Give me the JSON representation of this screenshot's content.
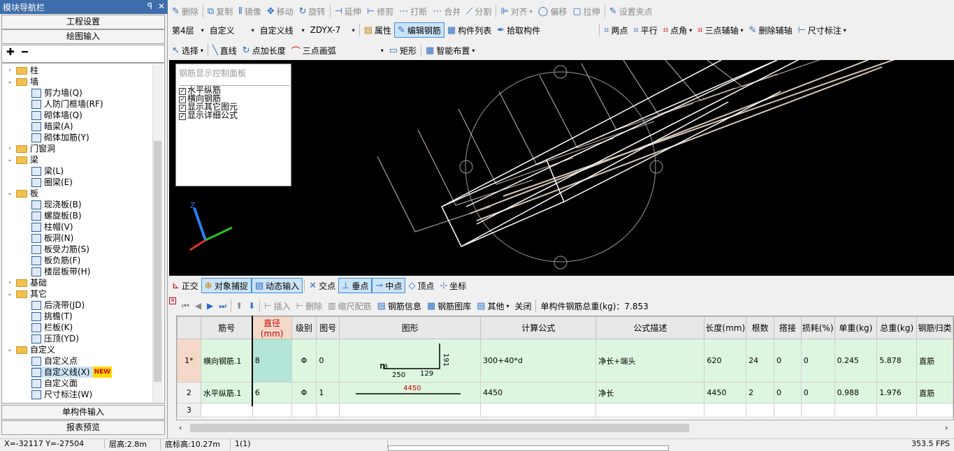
{
  "nav": {
    "title": "模块导航栏",
    "pin": "ᵖ",
    "close": "✕",
    "btn_project": "工程设置",
    "btn_draw": "绘图输入",
    "btn_single": "单构件输入",
    "btn_report": "报表预览",
    "tree_tools": "✚ ━",
    "tree": [
      {
        "label": "柱",
        "exp": "›",
        "type": "folder",
        "level": 0
      },
      {
        "label": "墙",
        "exp": "⌄",
        "type": "folder",
        "level": 0
      },
      {
        "label": "剪力墙(Q)",
        "type": "item",
        "level": 1
      },
      {
        "label": "人防门框墙(RF)",
        "type": "item",
        "level": 1
      },
      {
        "label": "砌体墙(Q)",
        "type": "item",
        "level": 1
      },
      {
        "label": "暗梁(A)",
        "type": "item",
        "level": 1
      },
      {
        "label": "砌体加筋(Y)",
        "type": "item",
        "level": 1
      },
      {
        "label": "门窗洞",
        "exp": "›",
        "type": "folder",
        "level": 0
      },
      {
        "label": "梁",
        "exp": "⌄",
        "type": "folder",
        "level": 0
      },
      {
        "label": "梁(L)",
        "type": "item",
        "level": 1
      },
      {
        "label": "圈梁(E)",
        "type": "item",
        "level": 1
      },
      {
        "label": "板",
        "exp": "⌄",
        "type": "folder",
        "level": 0
      },
      {
        "label": "现浇板(B)",
        "type": "item",
        "level": 1
      },
      {
        "label": "螺旋板(B)",
        "type": "item",
        "level": 1
      },
      {
        "label": "柱帽(V)",
        "type": "item",
        "level": 1
      },
      {
        "label": "板洞(N)",
        "type": "item",
        "level": 1
      },
      {
        "label": "板受力筋(S)",
        "type": "item",
        "level": 1
      },
      {
        "label": "板负筋(F)",
        "type": "item",
        "level": 1
      },
      {
        "label": "楼层板带(H)",
        "type": "item",
        "level": 1
      },
      {
        "label": "基础",
        "exp": "›",
        "type": "folder",
        "level": 0
      },
      {
        "label": "其它",
        "exp": "⌄",
        "type": "folder",
        "level": 0
      },
      {
        "label": "后浇带(JD)",
        "type": "item",
        "level": 1
      },
      {
        "label": "挑檐(T)",
        "type": "item",
        "level": 1
      },
      {
        "label": "栏板(K)",
        "type": "item",
        "level": 1
      },
      {
        "label": "压顶(YD)",
        "type": "item",
        "level": 1
      },
      {
        "label": "自定义",
        "exp": "⌄",
        "type": "folder",
        "level": 0
      },
      {
        "label": "自定义点",
        "type": "item",
        "level": 1
      },
      {
        "label": "自定义线(X)",
        "type": "item",
        "level": 1,
        "badge": "NEW"
      },
      {
        "label": "自定义面",
        "type": "item",
        "level": 1
      },
      {
        "label": "尺寸标注(W)",
        "type": "item",
        "level": 1
      }
    ]
  },
  "toolbar1": [
    "删除",
    "复制",
    "镜像",
    "移动",
    "旋转",
    "延伸",
    "修剪",
    "打断",
    "合并",
    "分割",
    "对齐",
    "偏移",
    "拉伸",
    "设置夹点"
  ],
  "toolbar2": {
    "floor": "第4层",
    "cat": "自定义",
    "type": "自定义线",
    "name": "ZDYX-7",
    "btn_prop": "属性",
    "btn_edit": "编辑钢筋",
    "btn_list": "构件列表",
    "btn_pick": "拾取构件",
    "right": [
      "两点",
      "平行",
      "点角",
      "三点辅轴",
      "删除辅轴",
      "尺寸标注"
    ]
  },
  "toolbar3": {
    "select": "选择",
    "line": "直线",
    "addlen": "点加长度",
    "arc": "三点画弧",
    "rect": "矩形",
    "smart": "智能布置"
  },
  "control_panel": {
    "title": "钢筋显示控制面板",
    "items": [
      "水平纵筋",
      "横向钢筋",
      "显示其它图元",
      "显示详细公式"
    ]
  },
  "snap": [
    "正交",
    "对象捕捉",
    "动态输入",
    "交点",
    "垂点",
    "中点",
    "顶点",
    "坐标"
  ],
  "grid_tools": {
    "insert": "插入",
    "delete": "删除",
    "scale": "缩尺配筋",
    "info": "钢筋信息",
    "lib": "钢筋图库",
    "other": "其他",
    "close": "关闭",
    "total_label": "单构件钢筋总重(kg)：7.853"
  },
  "table": {
    "headers": [
      "",
      "筋号",
      "直径(mm)",
      "级别",
      "图号",
      "图形",
      "计算公式",
      "公式描述",
      "长度(mm)",
      "根数",
      "搭接",
      "损耗(%)",
      "单重(kg)",
      "总重(kg)",
      "钢筋归类"
    ],
    "rows": [
      [
        "1*",
        "横向钢筋.1",
        "8",
        "Φ",
        "0",
        "",
        "300+40*d",
        "净长+端头",
        "620",
        "24",
        "0",
        "0",
        "0.245",
        "5.878",
        "直筋"
      ],
      [
        "2",
        "水平纵筋.1",
        "6",
        "Φ",
        "1",
        "",
        "4450",
        "净长",
        "4450",
        "2",
        "0",
        "0",
        "0.988",
        "1.976",
        "直筋"
      ],
      [
        "3",
        "",
        "",
        "",
        "",
        "",
        "",
        "",
        "",
        "",
        "",
        "",
        "",
        "",
        ""
      ]
    ],
    "shape1": {
      "a": "250",
      "b": "129",
      "c": "191",
      "d": "8"
    },
    "shape2": {
      "len": "4450"
    }
  },
  "status": {
    "coords": "X=-32117 Y=-27504",
    "floor_h": "层高:2.8m",
    "base_h": "底标高:10.27m",
    "sel": "1(1)",
    "fps": "353.5 FPS"
  }
}
